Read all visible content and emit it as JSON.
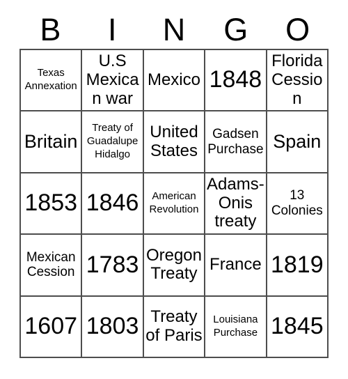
{
  "card": {
    "title_letters": [
      "B",
      "I",
      "N",
      "G",
      "O"
    ],
    "rows": [
      [
        {
          "text": "Texas Annexation",
          "size": "xs"
        },
        {
          "text": "U.S Mexican war",
          "size": "md"
        },
        {
          "text": "Mexico",
          "size": "md"
        },
        {
          "text": "1848",
          "size": "xl"
        },
        {
          "text": "Florida Cession",
          "size": "md"
        }
      ],
      [
        {
          "text": "Britain",
          "size": "lg"
        },
        {
          "text": "Treaty of Guadalupe Hidalgo",
          "size": "xs"
        },
        {
          "text": "United States",
          "size": "md"
        },
        {
          "text": "Gadsen Purchase",
          "size": "sm"
        },
        {
          "text": "Spain",
          "size": "lg"
        }
      ],
      [
        {
          "text": "1853",
          "size": "xl"
        },
        {
          "text": "1846",
          "size": "xl"
        },
        {
          "text": "American Revolution",
          "size": "xs"
        },
        {
          "text": "Adams-Onis treaty",
          "size": "md"
        },
        {
          "text": "13 Colonies",
          "size": "sm"
        }
      ],
      [
        {
          "text": "Mexican Cession",
          "size": "sm"
        },
        {
          "text": "1783",
          "size": "xl"
        },
        {
          "text": "Oregon Treaty",
          "size": "md"
        },
        {
          "text": "France",
          "size": "md"
        },
        {
          "text": "1819",
          "size": "xl"
        }
      ],
      [
        {
          "text": "1607",
          "size": "xl"
        },
        {
          "text": "1803",
          "size": "xl"
        },
        {
          "text": "Treaty of Paris",
          "size": "md"
        },
        {
          "text": "Louisiana Purchase",
          "size": "xs"
        },
        {
          "text": "1845",
          "size": "xl"
        }
      ]
    ],
    "colors": {
      "background": "#ffffff",
      "text": "#000000",
      "grid_line": "#4d4d4d"
    }
  }
}
